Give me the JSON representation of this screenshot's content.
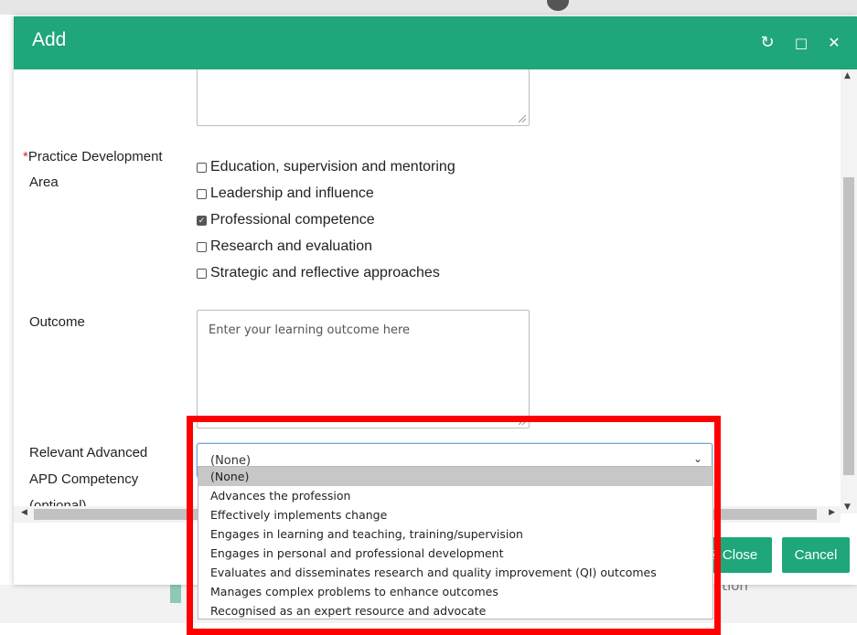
{
  "dialog": {
    "title": "Add",
    "buttons": {
      "refresh_icon": "↻",
      "maximize_icon": "□",
      "close_icon": "✕"
    }
  },
  "form": {
    "practice_area": {
      "required_mark": "*",
      "label_line1": "Practice Development",
      "label_line2": "Area",
      "options": [
        {
          "label": "Education, supervision and mentoring",
          "checked": false
        },
        {
          "label": "Leadership and influence",
          "checked": false
        },
        {
          "label": "Professional competence",
          "checked": true
        },
        {
          "label": "Research and evaluation",
          "checked": false
        },
        {
          "label": "Strategic and reflective approaches",
          "checked": false
        }
      ]
    },
    "outcome": {
      "label": "Outcome",
      "placeholder": "Enter your learning outcome here"
    },
    "competency": {
      "label_line1": "Relevant Advanced",
      "label_line2": "APD Competency",
      "label_line3": "(optional)",
      "selected": "(None)",
      "options": [
        "(None)",
        "Advances the profession",
        "Effectively implements change",
        "Engages in learning and teaching, training/supervision",
        "Engages in personal and professional development",
        "Evaluates and disseminates research and quality improvement (QI) outcomes",
        "Manages complex problems to enhance outcomes",
        "Recognised as an expert resource and advocate"
      ]
    }
  },
  "footer": {
    "save_close_label": "& Close",
    "cancel_label": "Cancel"
  },
  "background": {
    "partial_text": "ation"
  },
  "colors": {
    "accent": "#1fa67b",
    "highlight": "#ff0000"
  }
}
